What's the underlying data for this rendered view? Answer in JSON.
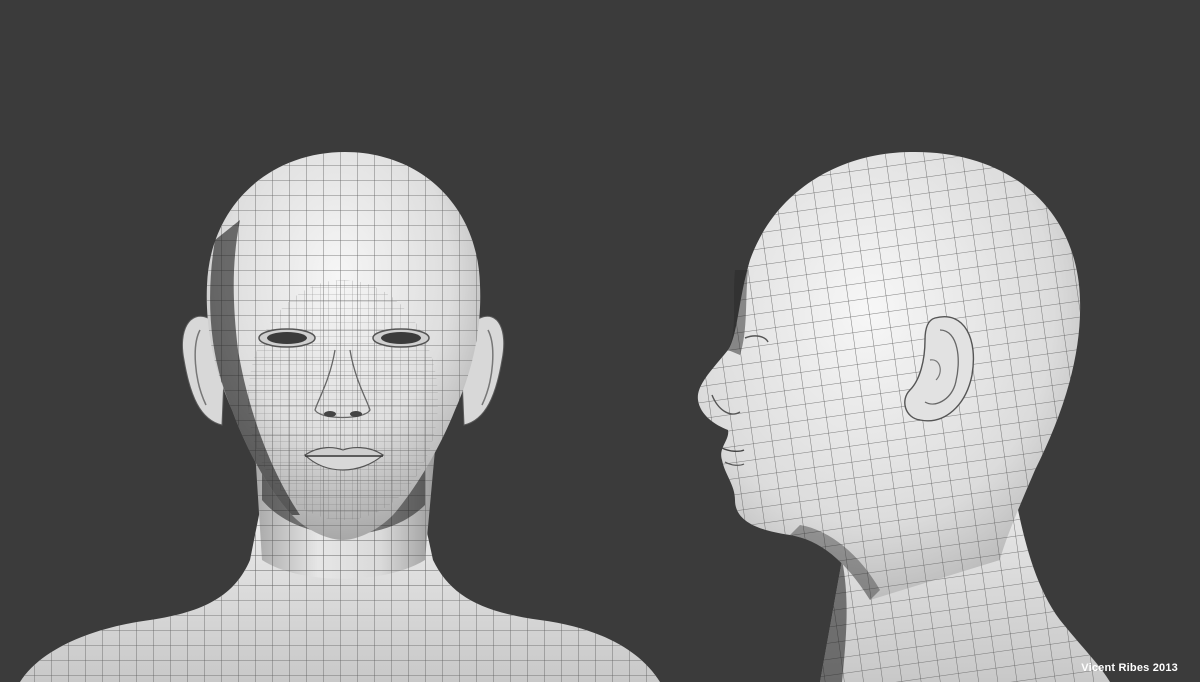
{
  "watermark": {
    "text": "Vicent Ribes 2013"
  },
  "colors": {
    "background": "#3b3b3b",
    "skin_light": "#efefef",
    "skin_mid": "#c9c9c9",
    "skin_dark": "#6e6e6e",
    "wireframe": "#5a5a5a"
  },
  "views": [
    "front-view",
    "side-profile-view"
  ]
}
